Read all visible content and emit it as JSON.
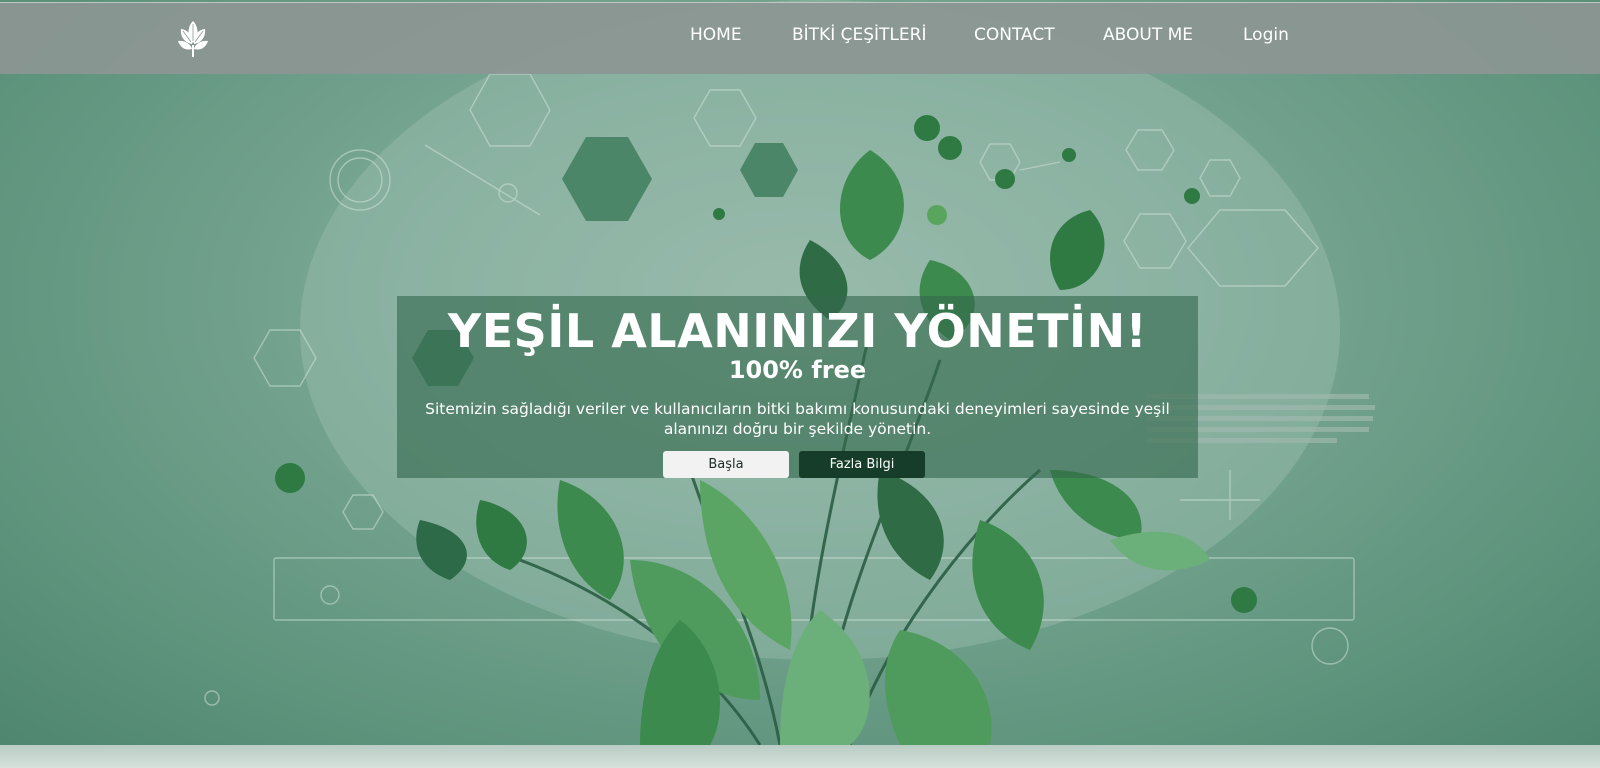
{
  "nav": {
    "items": [
      {
        "label": "HOME"
      },
      {
        "label": "BİTKİ ÇEŞİTLERİ"
      },
      {
        "label": "CONTACT"
      },
      {
        "label": "ABOUT ME"
      },
      {
        "label": "Login"
      }
    ]
  },
  "hero": {
    "title": "YEŞİL ALANINIZI YÖNETİN!",
    "subtitle": "100% free",
    "description": "Sitemizin sağladığı veriler ve kullanıcıların bitki bakımı konusundaki deneyimleri sayesinde yeşil alanınızı doğru bir şekilde yönetin.",
    "primary_button": "Başla",
    "secondary_button": "Fazla Bilgi"
  },
  "icons": {
    "logo": "leaf-logo-icon"
  },
  "colors": {
    "navbar": "#8c9692",
    "hero_green": "#6f9f89",
    "card_overlay": "#34694e",
    "secondary_button": "#163d2a",
    "primary_button": "#f1f2f1"
  }
}
